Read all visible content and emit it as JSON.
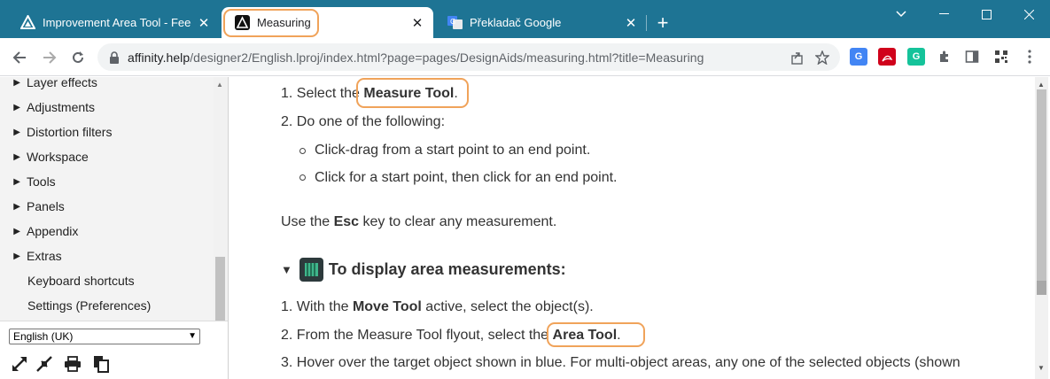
{
  "browser": {
    "tabs": [
      {
        "title": "Improvement Area Tool - Feedback",
        "favicon": "affinity-logo",
        "active": false
      },
      {
        "title": "Measuring",
        "favicon": "affinity-logo",
        "active": true
      },
      {
        "title": "Překladač Google",
        "favicon": "google-translate-logo",
        "active": false
      }
    ],
    "new_tab_label": "+",
    "url_host": "affinity.help",
    "url_path": "/designer2/English.lproj/index.html?page=pages/DesignAids/measuring.html?title=Measuring",
    "colors": {
      "tab_strip": "#1e7494",
      "highlight": "#f0a35a"
    }
  },
  "sidebar": {
    "items": [
      {
        "label": "Layer effects",
        "expandable": true
      },
      {
        "label": "Adjustments",
        "expandable": true
      },
      {
        "label": "Distortion filters",
        "expandable": true
      },
      {
        "label": "Workspace",
        "expandable": true
      },
      {
        "label": "Tools",
        "expandable": true
      },
      {
        "label": "Panels",
        "expandable": true
      },
      {
        "label": "Appendix",
        "expandable": true
      },
      {
        "label": "Extras",
        "expandable": true
      },
      {
        "label": "Keyboard shortcuts",
        "expandable": false
      },
      {
        "label": "Settings (Preferences)",
        "expandable": false
      }
    ],
    "language": "English (UK)"
  },
  "content": {
    "steps1": [
      {
        "num": "1.",
        "pre": "Select the ",
        "bold": "Measure Tool",
        "post": "."
      },
      {
        "num": "2.",
        "pre": "Do one of the following:",
        "bold": "",
        "post": ""
      }
    ],
    "bullets": [
      "Click-drag from a start point to an end point.",
      "Click for a start point, then click for an end point."
    ],
    "esc_note": {
      "pre": "Use the ",
      "bold": "Esc",
      "post": " key to clear any measurement."
    },
    "section_heading": "To display area measurements:",
    "steps2": [
      {
        "num": "1.",
        "pre": "With the ",
        "bold": "Move Tool",
        "post": " active, select the object(s)."
      },
      {
        "num": "2.",
        "pre": "From the Measure Tool flyout, select the ",
        "bold": "Area Tool",
        "post": "."
      },
      {
        "num": "3.",
        "pre": "Hover over the target object shown in blue. For multi-object areas, any one of the selected objects (shown",
        "bold": "",
        "post": ""
      }
    ]
  }
}
